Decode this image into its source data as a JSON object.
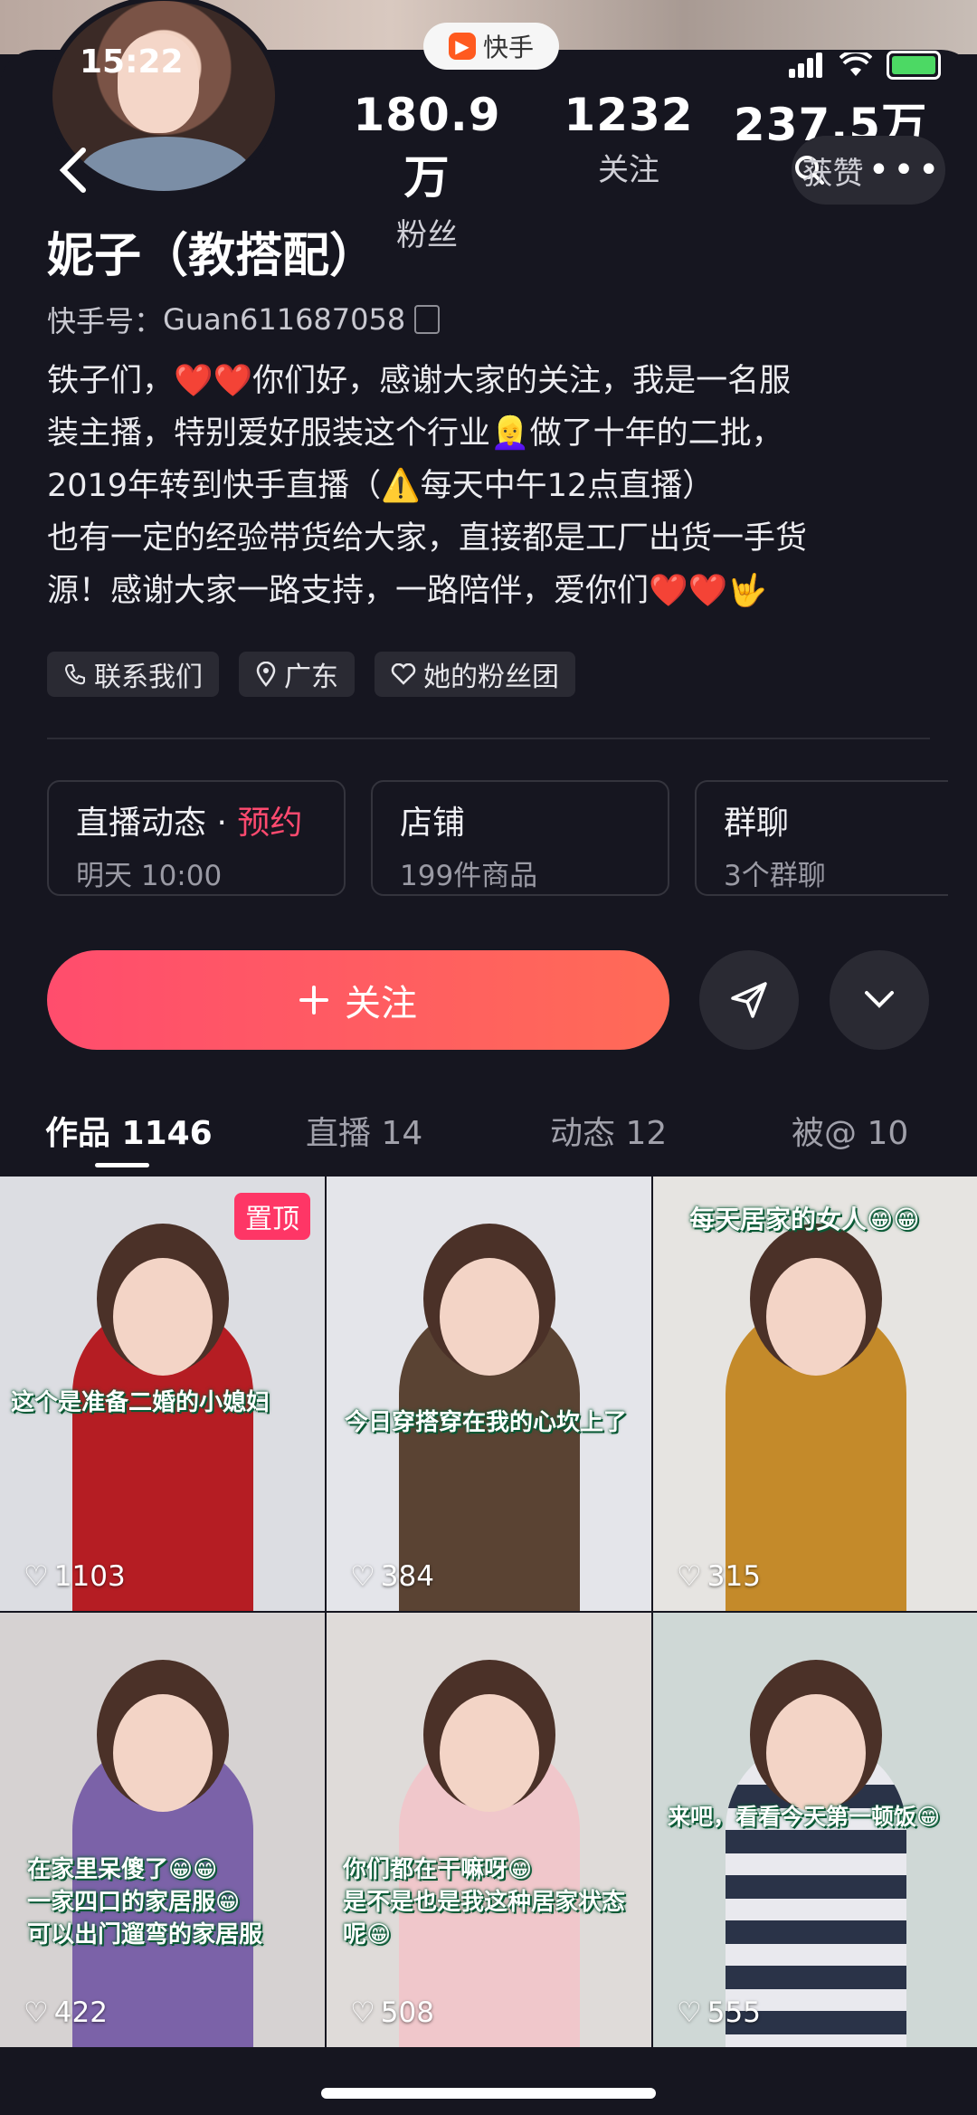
{
  "status": {
    "time": "15:22"
  },
  "top_badge": {
    "label": "快手"
  },
  "profile": {
    "name": "妮子（教搭配）",
    "id_label": "快手号：",
    "id_value": "Guan611687058",
    "bio_lines": [
      "铁子们，❤️❤️你们好，感谢大家的关注，我是一名服",
      "装主播，特别爱好服装这个行业👱‍♀️做了十年的二批，",
      "2019年转到快手直播（⚠️每天中午12点直播）",
      "也有一定的经验带货给大家，直接都是工厂出货一手货",
      "源！感谢大家一路支持，一路陪伴，爱你们❤️❤️🤟"
    ]
  },
  "stats": [
    {
      "num": "180.9万",
      "label": "粉丝"
    },
    {
      "num": "1232",
      "label": "关注"
    },
    {
      "num": "237.5万",
      "label": "获赞"
    }
  ],
  "tags": [
    "联系我们",
    "广东",
    "她的粉丝团"
  ],
  "cards": [
    {
      "title": "直播动态",
      "sep": " · ",
      "highlight": "预约",
      "sub": "明天 10:00"
    },
    {
      "title": "店铺",
      "sub": "199件商品"
    },
    {
      "title": "群聊",
      "sub": "3个群聊"
    }
  ],
  "follow_label": "关注",
  "tabs": [
    {
      "label": "作品 1146"
    },
    {
      "label": "直播 14"
    },
    {
      "label": "动态 12"
    },
    {
      "label": "被@ 10"
    }
  ],
  "videos": [
    {
      "likes": "1103",
      "pinned": "置顶",
      "caption": [
        "这个是准备二婚的小媳妇"
      ],
      "colors": {
        "room": "#dcdde2",
        "outfit": "#b51d23"
      }
    },
    {
      "likes": "384",
      "caption": [
        "今日穿搭穿在我的心坎上了"
      ],
      "colors": {
        "room": "#e4e5ea",
        "outfit": "#5a4333"
      }
    },
    {
      "likes": "315",
      "caption": [
        "每天居家的女人😁😁"
      ],
      "colors": {
        "room": "#e6e4e1",
        "outfit": "#c48a2a"
      }
    },
    {
      "likes": "422",
      "caption": [
        "在家里呆傻了😁😁",
        "一家四口的家居服😁",
        "可以出门遛弯的家居服"
      ],
      "colors": {
        "room": "#d6d2d2",
        "outfit": "#7b62a8"
      }
    },
    {
      "likes": "508",
      "caption": [
        "你们都在干嘛呀😁",
        "是不是也是我这种居家状态",
        "呢😁"
      ],
      "colors": {
        "room": "#dfdbd9",
        "outfit": "#f0c7cb"
      }
    },
    {
      "likes": "555",
      "caption": [
        "来吧，看看今天第一顿饭😁"
      ],
      "colors": {
        "room": "#cfd8d6",
        "outfit": "#2a3348"
      }
    }
  ]
}
